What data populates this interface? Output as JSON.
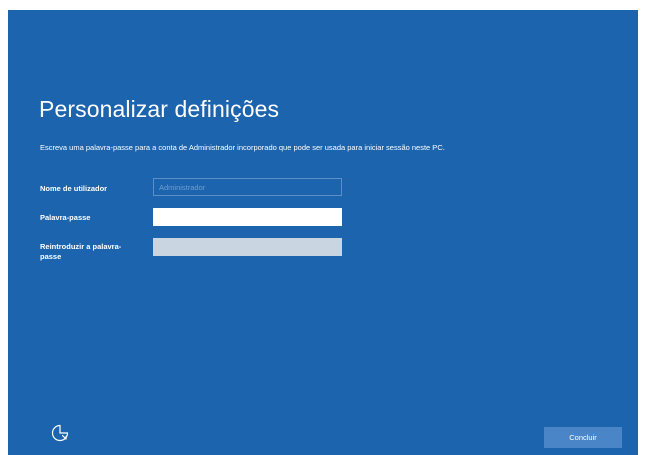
{
  "setup": {
    "title": "Personalizar definições",
    "description": "Escreva uma palavra-passe para a conta de Administrador incorporado que pode ser usada para iniciar sessão neste PC.",
    "fields": {
      "username": {
        "label": "Nome de utilizador",
        "placeholder": "Administrador",
        "value": ""
      },
      "password": {
        "label": "Palavra-passe",
        "value": ""
      },
      "reenter": {
        "label": "Reintroduzir a palavra-passe",
        "value": ""
      }
    }
  },
  "footer": {
    "accessibility_icon": "ease-of-access-icon",
    "finish_label": "Concluir"
  },
  "colors": {
    "background": "#1c64ae",
    "button": "#4a86c7",
    "text": "#ffffff"
  }
}
